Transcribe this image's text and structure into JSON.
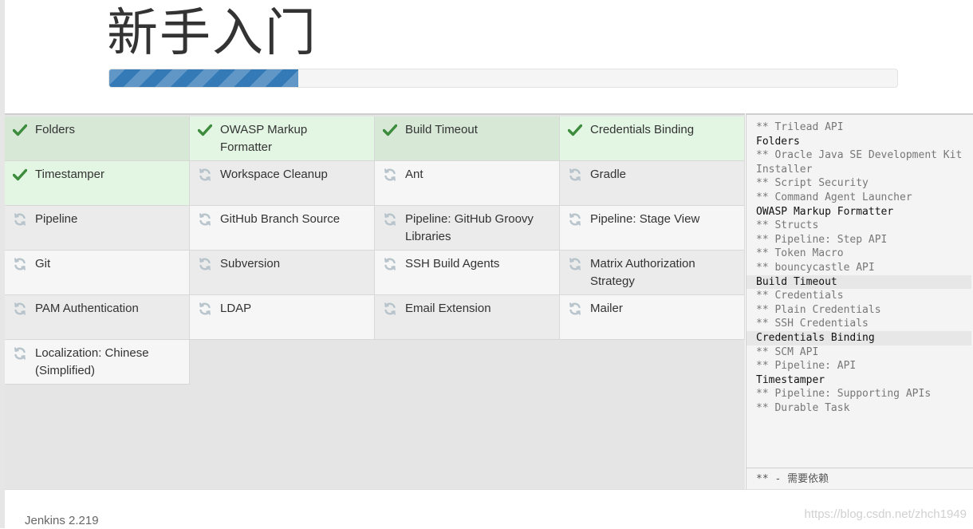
{
  "header": {
    "title": "新手入门",
    "progress": 0.24
  },
  "plugins": [
    {
      "label": "Folders",
      "status": "success"
    },
    {
      "label": "OWASP Markup\nFormatter",
      "status": "success"
    },
    {
      "label": "Build Timeout",
      "status": "success"
    },
    {
      "label": "Credentials Binding",
      "status": "success"
    },
    {
      "label": "Timestamper",
      "status": "success"
    },
    {
      "label": "Workspace Cleanup",
      "status": "pending"
    },
    {
      "label": "Ant",
      "status": "pending"
    },
    {
      "label": "Gradle",
      "status": "pending"
    },
    {
      "label": "Pipeline",
      "status": "pending"
    },
    {
      "label": "GitHub Branch Source",
      "status": "pending"
    },
    {
      "label": "Pipeline: GitHub Groovy\nLibraries",
      "status": "pending"
    },
    {
      "label": "Pipeline: Stage View",
      "status": "pending"
    },
    {
      "label": "Git",
      "status": "pending"
    },
    {
      "label": "Subversion",
      "status": "pending"
    },
    {
      "label": "SSH Build Agents",
      "status": "pending"
    },
    {
      "label": "Matrix Authorization\nStrategy",
      "status": "pending"
    },
    {
      "label": "PAM Authentication",
      "status": "pending"
    },
    {
      "label": "LDAP",
      "status": "pending"
    },
    {
      "label": "Email Extension",
      "status": "pending"
    },
    {
      "label": "Mailer",
      "status": "pending"
    },
    {
      "label": "Localization: Chinese\n(Simplified)",
      "status": "pending"
    }
  ],
  "log": {
    "lines": [
      {
        "text": "** Trilead API",
        "kind": "dep"
      },
      {
        "text": "Folders",
        "kind": "plugin"
      },
      {
        "text": "** Oracle Java SE Development Kit\nInstaller",
        "kind": "dep"
      },
      {
        "text": "** Script Security",
        "kind": "dep"
      },
      {
        "text": "** Command Agent Launcher",
        "kind": "dep"
      },
      {
        "text": "OWASP Markup Formatter",
        "kind": "plugin"
      },
      {
        "text": "** Structs",
        "kind": "dep"
      },
      {
        "text": "** Pipeline: Step API",
        "kind": "dep"
      },
      {
        "text": "** Token Macro",
        "kind": "dep"
      },
      {
        "text": "** bouncycastle API",
        "kind": "dep"
      },
      {
        "text": "Build Timeout",
        "kind": "plugin",
        "highlight": true
      },
      {
        "text": "** Credentials",
        "kind": "dep"
      },
      {
        "text": "** Plain Credentials",
        "kind": "dep"
      },
      {
        "text": "** SSH Credentials",
        "kind": "dep"
      },
      {
        "text": "Credentials Binding",
        "kind": "plugin",
        "highlight": true
      },
      {
        "text": "** SCM API",
        "kind": "dep"
      },
      {
        "text": "** Pipeline: API",
        "kind": "dep"
      },
      {
        "text": "Timestamper",
        "kind": "plugin"
      },
      {
        "text": "** Pipeline: Supporting APIs",
        "kind": "dep"
      },
      {
        "text": "** Durable Task",
        "kind": "dep"
      }
    ],
    "legend": "** - 需要依赖"
  },
  "footer": {
    "version": "Jenkins 2.219",
    "watermark": "https://blog.csdn.net/zhch1949"
  },
  "colors": {
    "success_a": "#d7e8d7",
    "success_b": "#e3f6e3",
    "pending_a": "#ebebeb",
    "pending_b": "#f6f6f6",
    "check": "#3d8b3d",
    "spinner": "#b8c4cc",
    "progress": "#337ab7"
  },
  "icons": {
    "success": "check-icon",
    "pending": "refresh-icon"
  }
}
